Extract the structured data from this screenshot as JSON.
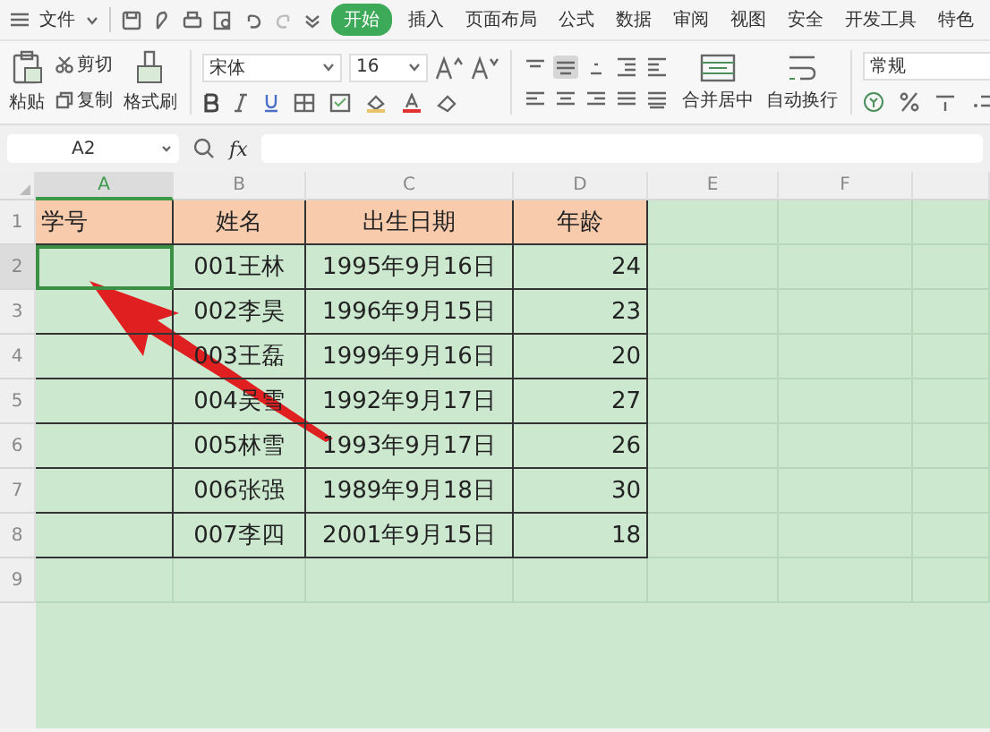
{
  "menu": {
    "file": "文件",
    "tabs": [
      {
        "label": "开始",
        "selected": true
      },
      {
        "label": "插入",
        "selected": false
      },
      {
        "label": "页面布局",
        "selected": false
      },
      {
        "label": "公式",
        "selected": false
      },
      {
        "label": "数据",
        "selected": false
      },
      {
        "label": "审阅",
        "selected": false
      },
      {
        "label": "视图",
        "selected": false
      },
      {
        "label": "安全",
        "selected": false
      },
      {
        "label": "开发工具",
        "selected": false
      },
      {
        "label": "特色",
        "selected": false
      }
    ]
  },
  "toolbar": {
    "paste": "粘贴",
    "cut": "剪切",
    "copy": "复制",
    "format_painter": "格式刷",
    "font": "宋体",
    "font_size": "16",
    "align_buttons": [
      {
        "selected": false
      },
      {
        "selected": true
      },
      {
        "selected": false
      },
      {
        "selected": false
      },
      {
        "selected": false
      }
    ],
    "merge": "合并居中",
    "wrap": "自动换行",
    "number_format": "常规"
  },
  "formula_bar": {
    "name_box": "A2",
    "fx": "fx"
  },
  "columns": [
    {
      "label": "A",
      "selected": true
    },
    {
      "label": "B",
      "selected": false
    },
    {
      "label": "C",
      "selected": false
    },
    {
      "label": "D",
      "selected": false
    },
    {
      "label": "E",
      "selected": false
    },
    {
      "label": "F",
      "selected": false
    }
  ],
  "rows": [
    {
      "number": "1",
      "kind": "header",
      "selected": false,
      "cells": [
        "学号",
        "姓名",
        "出生日期",
        "年龄"
      ]
    },
    {
      "number": "2",
      "kind": "data",
      "selected": true,
      "cells": [
        "",
        "001王林",
        "1995年9月16日",
        "24"
      ]
    },
    {
      "number": "3",
      "kind": "data",
      "selected": false,
      "cells": [
        "",
        "002李昊",
        "1996年9月15日",
        "23"
      ]
    },
    {
      "number": "4",
      "kind": "data",
      "selected": false,
      "cells": [
        "",
        "003王磊",
        "1999年9月16日",
        "20"
      ]
    },
    {
      "number": "5",
      "kind": "data",
      "selected": false,
      "cells": [
        "",
        "004吴雪",
        "1992年9月17日",
        "27"
      ]
    },
    {
      "number": "6",
      "kind": "data",
      "selected": false,
      "cells": [
        "",
        "005林雪",
        "1993年9月17日",
        "26"
      ]
    },
    {
      "number": "7",
      "kind": "data",
      "selected": false,
      "cells": [
        "",
        "006张强",
        "1989年9月18日",
        "30"
      ]
    },
    {
      "number": "8",
      "kind": "data",
      "selected": false,
      "cells": [
        "",
        "007李四",
        "2001年9月15日",
        "18"
      ]
    },
    {
      "number": "9",
      "kind": "empty",
      "selected": false,
      "cells": []
    }
  ]
}
